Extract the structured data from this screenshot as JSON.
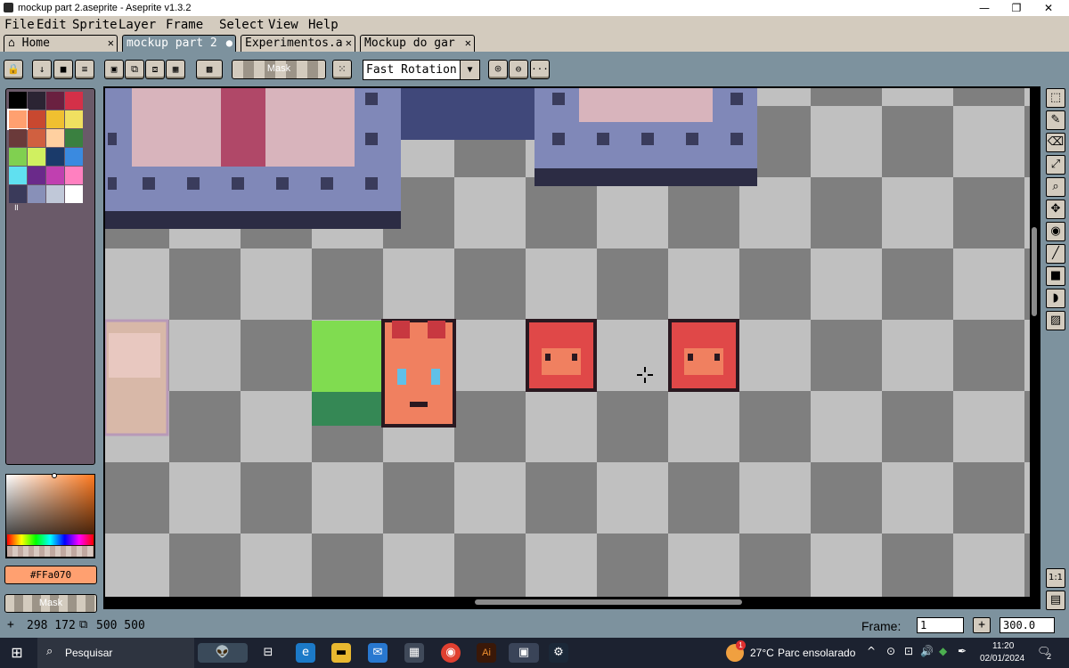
{
  "window": {
    "title": "mockup part 2.aseprite - Aseprite v1.3.2",
    "minimize": "—",
    "maximize": "❐",
    "close": "✕"
  },
  "menu": [
    "File",
    "Edit",
    "Sprite",
    "Layer",
    "Frame",
    "Select",
    "View",
    "Help"
  ],
  "tabs": [
    {
      "label": "Home",
      "icon": "home-icon",
      "close": "✕"
    },
    {
      "label": "mockup part 2",
      "modified": "●",
      "active": true
    },
    {
      "label": "Experimentos.a",
      "close": "✕"
    },
    {
      "label": "Mockup do gar",
      "close": "✕"
    }
  ],
  "toolbar": {
    "mask_label": "Mask",
    "rotation_algorithm": "Fast Rotation",
    "more_label": "···"
  },
  "palette": {
    "colors": [
      "#000000",
      "#2b2433",
      "#6a2040",
      "#d43048",
      "#ffa070",
      "#c84830",
      "#f0c030",
      "#f0e060",
      "#6a3a3a",
      "#d06040",
      "#ffd0a0",
      "#3a8040",
      "#80d050",
      "#d0f060",
      "#1a3a6a",
      "#3a8ae0",
      "#60e0f0",
      "#6a2a8a",
      "#c040b0",
      "#ff80c0",
      "#3a3a5a",
      "#8890b8",
      "#c0c8d8",
      "#ffffff"
    ],
    "count_label": "॥"
  },
  "color": {
    "foreground_hex": "#FFa070",
    "foreground": "#ffa070",
    "mask_label": "Mask"
  },
  "status": {
    "cursor": "298 172",
    "selection": "500 500",
    "frame_label": "Frame:",
    "frame_value": "1",
    "add_label": "+",
    "zoom_value": "300.0"
  },
  "tools": [
    "rectangular-marquee-icon",
    "pencil-icon",
    "eraser-icon",
    "eyedropper-icon",
    "zoom-icon",
    "move-icon",
    "paint-bucket-icon",
    "line-icon",
    "rectangle-icon",
    "contour-icon",
    "blur-icon"
  ],
  "canvas_side": {
    "pixel_perfect": "1:1"
  },
  "taskbar": {
    "search_placeholder": "Pesquisar",
    "weather_temp": "27°C",
    "weather_desc": "Parc ensolarado",
    "time": "11:20",
    "date": "02/01/2024",
    "notifications": "2",
    "weather_badge": "1"
  }
}
